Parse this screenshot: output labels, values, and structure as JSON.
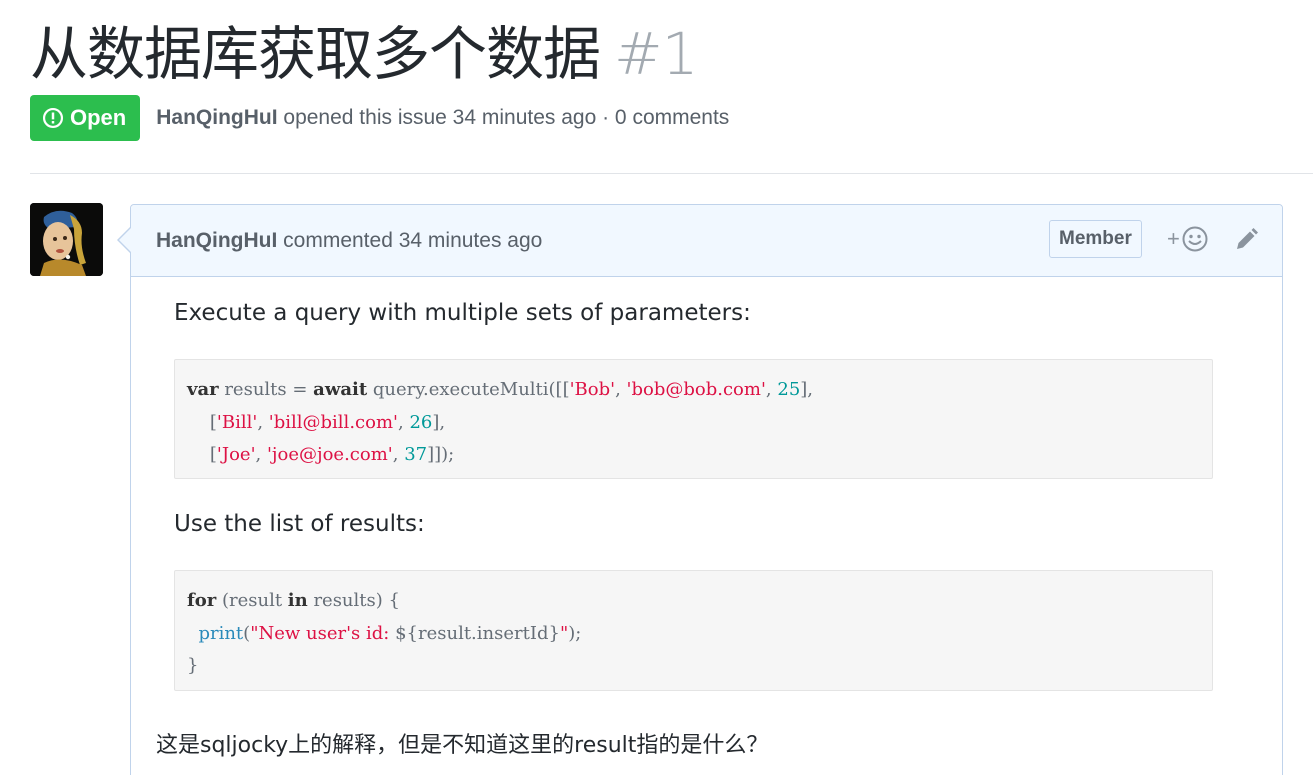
{
  "issue": {
    "title": "从数据库获取多个数据",
    "number": "#1",
    "state": "Open",
    "author": "HanQingHuI",
    "meta_rest": " opened this issue 34 minutes ago · 0 comments"
  },
  "comment": {
    "author": "HanQingHuI",
    "action": " commented 34 minutes ago",
    "role_badge": "Member",
    "reaction_label": "+",
    "body": {
      "para1": "Execute a query with multiple sets of parameters:",
      "code1": {
        "l1_kw1": "var",
        "l1_a": " results = ",
        "l1_kw2": "await",
        "l1_b": " query.executeMulti([[",
        "l1_s1": "'Bob'",
        "l1_c": ", ",
        "l1_s2": "'bob@bob.com'",
        "l1_d": ", ",
        "l1_n": "25",
        "l1_e": "],",
        "l2_a": "    [",
        "l2_s1": "'Bill'",
        "l2_b": ", ",
        "l2_s2": "'bill@bill.com'",
        "l2_c": ", ",
        "l2_n": "26",
        "l2_d": "],",
        "l3_a": "    [",
        "l3_s1": "'Joe'",
        "l3_b": ", ",
        "l3_s2": "'joe@joe.com'",
        "l3_c": ", ",
        "l3_n": "37",
        "l3_d": "]]);"
      },
      "para2": "Use the list of results:",
      "code2": {
        "l1_kw1": "for",
        "l1_a": " (result ",
        "l1_kw2": "in",
        "l1_b": " results) {",
        "l2_a": "  ",
        "l2_fn": "print",
        "l2_b": "(",
        "l2_s1": "\"New user's id: ",
        "l2_c": "${result.insertId}",
        "l2_s2": "\"",
        "l2_d": ");",
        "l3_a": "}"
      },
      "para3": "这是sqljocky上的解释，但是不知道这里的result指的是什么？"
    }
  },
  "colors": {
    "open_green": "#2cbe4e",
    "header_bg": "#f1f8ff",
    "border_blue": "#c0d3eb",
    "string_red": "#dd1144",
    "number_teal": "#009999"
  },
  "icons": {
    "state": "issue-opened-icon",
    "reaction": "smiley-icon",
    "edit": "pencil-icon"
  }
}
